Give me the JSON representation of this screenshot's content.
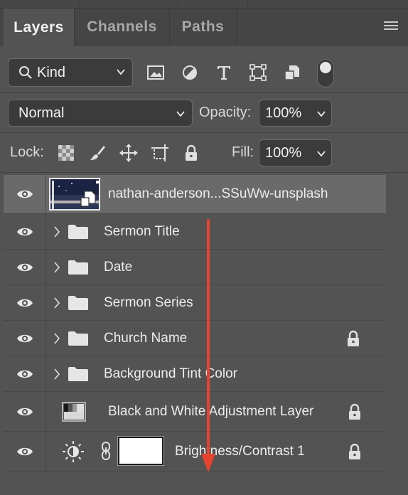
{
  "tabs": [
    {
      "label": "Layers"
    },
    {
      "label": "Channels"
    },
    {
      "label": "Paths"
    }
  ],
  "filter": {
    "kind_label": "Kind",
    "icons": [
      "image-filter-icon",
      "adjustment-filter-icon",
      "type-filter-icon",
      "shape-filter-icon",
      "smart-object-filter-icon"
    ]
  },
  "blend": {
    "mode": "Normal",
    "opacity_label": "Opacity:",
    "opacity_value": "100%"
  },
  "lock": {
    "label": "Lock:",
    "fill_label": "Fill:",
    "fill_value": "100%"
  },
  "layers": [
    {
      "name": "nathan-anderson...SSuWw-unsplash",
      "type": "smart-object",
      "selected": true,
      "locked": false
    },
    {
      "name": "Sermon Title",
      "type": "group",
      "locked": false
    },
    {
      "name": "Date",
      "type": "group",
      "locked": false
    },
    {
      "name": "Sermon Series",
      "type": "group",
      "locked": false
    },
    {
      "name": "Church Name",
      "type": "group",
      "locked": true
    },
    {
      "name": "Background Tint Color",
      "type": "group",
      "locked": false
    },
    {
      "name": "Black and White Adjustment Layer",
      "type": "adjustment",
      "locked": true
    },
    {
      "name": "Brightness/Contrast 1",
      "type": "adjustment-masked",
      "locked": true
    }
  ],
  "colors": {
    "panel": "#535353",
    "selected_row": "#6a6a6a",
    "annotation_arrow": "#e8432e"
  }
}
